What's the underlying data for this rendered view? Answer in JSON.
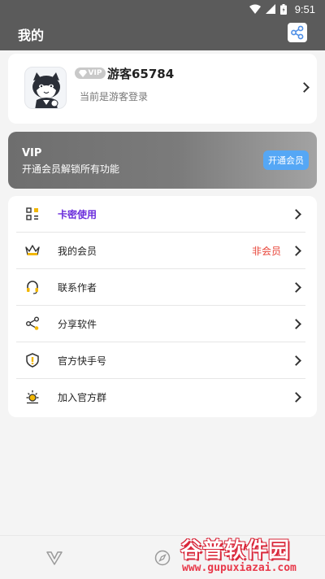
{
  "status_bar": {
    "time": "9:51"
  },
  "header": {
    "title": "我的"
  },
  "profile": {
    "vip_badge": "VIP",
    "username": "游客65784",
    "note": "当前是游客登录"
  },
  "vip_banner": {
    "title": "VIP",
    "subtitle": "开通会员解锁所有功能",
    "button_label": "开通会员"
  },
  "menu": {
    "items": [
      {
        "label": "卡密使用",
        "value": "",
        "icon": "qr-card-icon",
        "highlight": true
      },
      {
        "label": "我的会员",
        "value": "非会员",
        "icon": "crown-icon"
      },
      {
        "label": "联系作者",
        "value": "",
        "icon": "headset-icon"
      },
      {
        "label": "分享软件",
        "value": "",
        "icon": "share-icon"
      },
      {
        "label": "官方快手号",
        "value": "",
        "icon": "shield-icon"
      },
      {
        "label": "加入官方群",
        "value": "",
        "icon": "sun-icon"
      }
    ]
  },
  "colors": {
    "header": "#5b5b5b",
    "highlight": "#6a2ddc",
    "non_member": "#e84438",
    "vip_button": "#55a7f5"
  },
  "watermark": {
    "title": "谷普软件园",
    "url": "www.gupuxiazai.com"
  }
}
